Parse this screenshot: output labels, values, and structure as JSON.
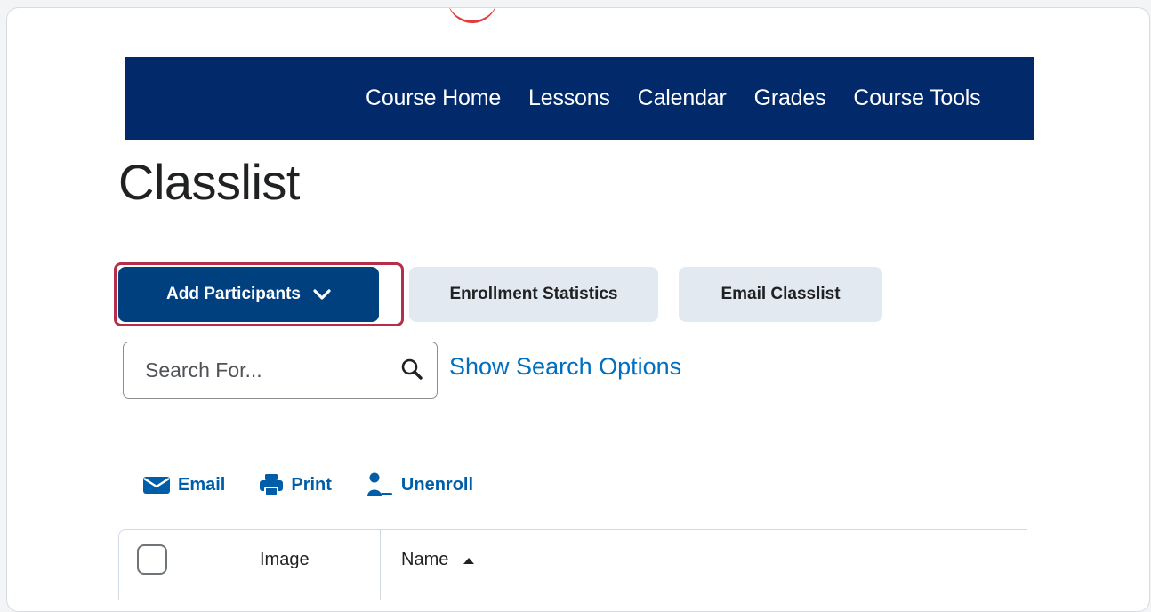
{
  "nav": {
    "items": [
      "Course Home",
      "Lessons",
      "Calendar",
      "Grades",
      "Course Tools"
    ]
  },
  "page": {
    "title": "Classlist"
  },
  "buttons": {
    "add_participants": "Add Participants",
    "enrollment_statistics": "Enrollment Statistics",
    "email_classlist": "Email Classlist"
  },
  "search": {
    "placeholder": "Search For...",
    "show_options": "Show Search Options"
  },
  "actions": {
    "email": "Email",
    "print": "Print",
    "unenroll": "Unenroll"
  },
  "table": {
    "headers": {
      "image": "Image",
      "name": "Name"
    }
  },
  "icons": {
    "chevron": "chevron-down-icon",
    "search": "search-icon",
    "email": "envelope-icon",
    "print": "printer-icon",
    "unenroll": "user-remove-icon",
    "sort": "sort-ascending-icon"
  },
  "colors": {
    "navbar": "#022a6b",
    "primary_button": "#01407f",
    "secondary_button": "#e3e9f1",
    "link": "#006fbf",
    "focus_ring": "#b52f4a"
  }
}
